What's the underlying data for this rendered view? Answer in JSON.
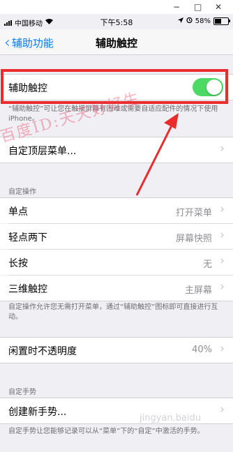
{
  "window": {
    "minimize": "−",
    "maximize": "□",
    "close": "✕"
  },
  "status": {
    "carrier": "中国移动",
    "time": "下午5:58",
    "battery": "58%",
    "battery_level": 0.58
  },
  "nav": {
    "back_label": "辅助功能",
    "title": "辅助触控"
  },
  "assistive_touch": {
    "label": "辅助触控",
    "enabled": true,
    "note": "“辅助触控”可让您在触摸屏幕有困难或需要自适应配件的情况下使用 iPhone。"
  },
  "customize": {
    "label": "自定顶层菜单..."
  },
  "custom_actions": {
    "header": "自定操作",
    "items": [
      {
        "label": "单点",
        "value": "打开菜单"
      },
      {
        "label": "轻点两下",
        "value": "屏幕快照"
      },
      {
        "label": "长按",
        "value": "无"
      },
      {
        "label": "三维触控",
        "value": "主屏幕"
      }
    ],
    "note": "自定操作允许您无需打开菜单，通过“辅助触控”图标即可直接进行互动。"
  },
  "idle_opacity": {
    "label": "闲置时不透明度",
    "value": "40%"
  },
  "custom_gestures": {
    "header": "自定手势",
    "create_label": "创建新手势...",
    "note": "自定手势让您能够记录可以从“菜单”下的“自定”中激活的手势。"
  },
  "watermark": {
    "text": "百度ID:天天好好生",
    "site": "jingyan.baidu"
  }
}
